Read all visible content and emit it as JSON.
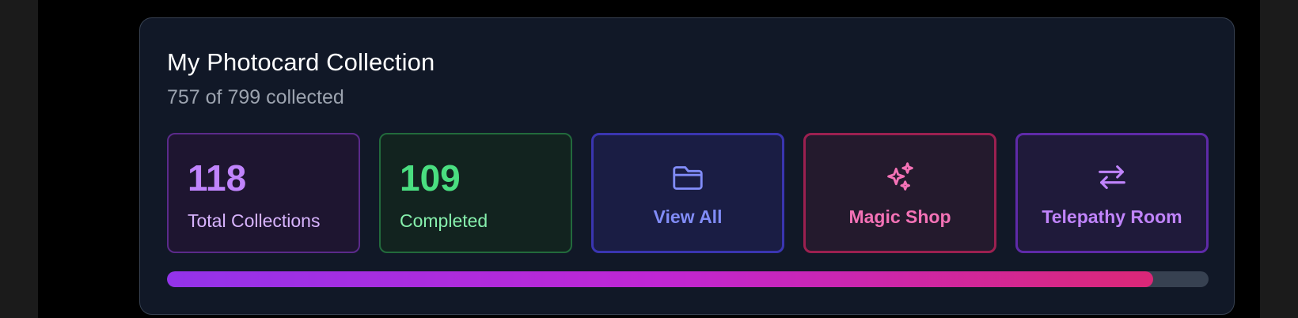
{
  "collection": {
    "title": "My Photocard Collection",
    "subtitle": "757 of 799 collected",
    "collected": 757,
    "total": 799,
    "progress_fraction": 0.947
  },
  "stats": [
    {
      "value": "118",
      "label": "Total Collections",
      "color": "#c084fc"
    },
    {
      "value": "109",
      "label": "Completed",
      "color": "#4ade80"
    }
  ],
  "actions": [
    {
      "label": "View All",
      "icon": "folder-icon",
      "color": "#818cf8"
    },
    {
      "label": "Magic Shop",
      "icon": "sparkles-icon",
      "color": "#f472b6"
    },
    {
      "label": "Telepathy Room",
      "icon": "arrows-swap-icon",
      "color": "#c084fc"
    }
  ],
  "colors": {
    "card_bg": "#111827",
    "card_border": "#374151",
    "progress_start": "#9333ea",
    "progress_end": "#db2777",
    "progress_track": "#374151"
  }
}
